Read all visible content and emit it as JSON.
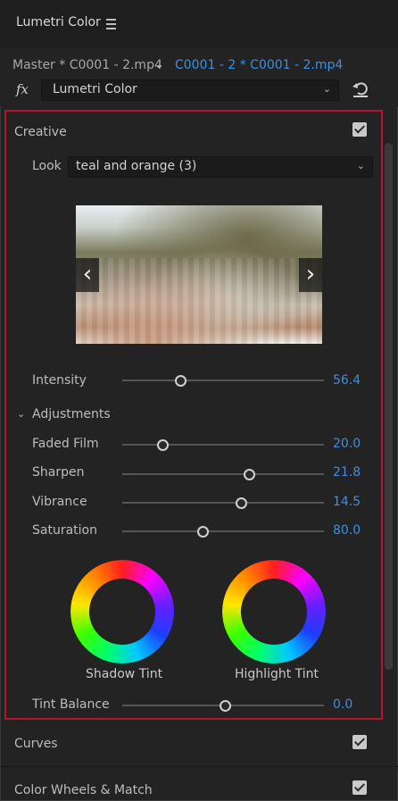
{
  "panel": {
    "title": "Lumetri Color"
  },
  "source": {
    "master": "Master * C0001 - 2.mp4",
    "clip": "C0001 - 2 * C0001 - 2.mp4"
  },
  "effect": {
    "fx_label": "fx",
    "name": "Lumetri Color"
  },
  "creative": {
    "title": "Creative",
    "enabled": true,
    "look_label": "Look",
    "look_value": "teal and orange (3)",
    "nav_prev": "‹",
    "nav_next": "›",
    "intensity": {
      "label": "Intensity",
      "value": "56.4",
      "fraction": 0.29
    },
    "adjustments": {
      "title": "Adjustments",
      "params": [
        {
          "label": "Faded Film",
          "value": "20.0",
          "fraction": 0.2
        },
        {
          "label": "Sharpen",
          "value": "21.8",
          "fraction": 0.63
        },
        {
          "label": "Vibrance",
          "value": "14.5",
          "fraction": 0.59
        },
        {
          "label": "Saturation",
          "value": "80.0",
          "fraction": 0.4
        }
      ]
    },
    "shadow_tint_label": "Shadow Tint",
    "highlight_tint_label": "Highlight Tint",
    "tint_balance": {
      "label": "Tint Balance",
      "value": "0.0",
      "fraction": 0.51
    }
  },
  "sections": [
    {
      "title": "Curves",
      "enabled": true
    },
    {
      "title": "Color Wheels & Match",
      "enabled": true
    }
  ],
  "colors": {
    "accent": "#3d8fe0",
    "highlight_border": "#b1162e",
    "background": "#232323"
  }
}
